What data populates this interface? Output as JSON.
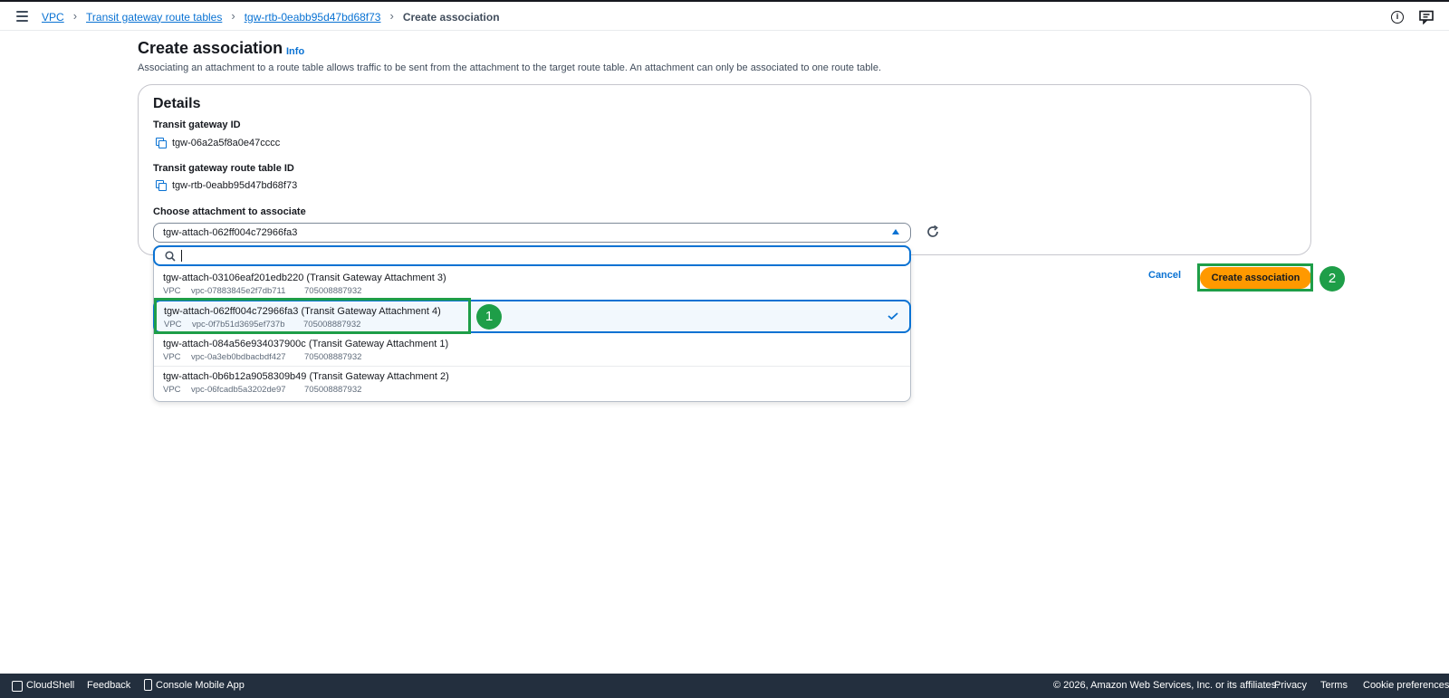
{
  "breadcrumb": {
    "items": [
      "VPC",
      "Transit gateway route tables",
      "tgw-rtb-0eabb95d47bd68f73"
    ],
    "current": "Create association"
  },
  "header": {
    "title": "Create association",
    "info_label": "Info",
    "description": "Associating an attachment to a route table allows traffic to be sent from the attachment to the target route table. An attachment can only be associated to one route table."
  },
  "details": {
    "title": "Details",
    "tgw_id_label": "Transit gateway ID",
    "tgw_id_value": "tgw-06a2a5f8a0e47cccc",
    "rtb_id_label": "Transit gateway route table ID",
    "rtb_id_value": "tgw-rtb-0eabb95d47bd68f73",
    "attachment_label": "Choose attachment to associate",
    "attachment_selected": "tgw-attach-062ff004c72966fa3"
  },
  "dropdown": {
    "options": [
      {
        "title": "tgw-attach-03106eaf201edb220 (Transit Gateway Attachment 3)",
        "type": "VPC",
        "vpc": "vpc-07883845e2f7db711",
        "account": "705008887932"
      },
      {
        "title": "tgw-attach-062ff004c72966fa3 (Transit Gateway Attachment 4)",
        "type": "VPC",
        "vpc": "vpc-0f7b51d3695ef737b",
        "account": "705008887932"
      },
      {
        "title": "tgw-attach-084a56e934037900c (Transit Gateway Attachment 1)",
        "type": "VPC",
        "vpc": "vpc-0a3eb0bdbacbdf427",
        "account": "705008887932"
      },
      {
        "title": "tgw-attach-0b6b12a9058309b49 (Transit Gateway Attachment 2)",
        "type": "VPC",
        "vpc": "vpc-06fcadb5a3202de97",
        "account": "705008887932"
      }
    ]
  },
  "actions": {
    "cancel_label": "Cancel",
    "create_label": "Create association"
  },
  "annotations": {
    "badge_1": "1",
    "badge_2": "2"
  },
  "footer": {
    "cloudshell": "CloudShell",
    "feedback": "Feedback",
    "mobile_app": "Console Mobile App",
    "copyright": "© 2026, Amazon Web Services, Inc. or its affiliates.",
    "privacy": "Privacy",
    "terms": "Terms",
    "cookie": "Cookie preferences"
  },
  "colors": {
    "accent": "#0972d3",
    "primary_button": "#ff9900",
    "annotation_green": "#1e9e48",
    "footer_bg": "#232f3e"
  }
}
